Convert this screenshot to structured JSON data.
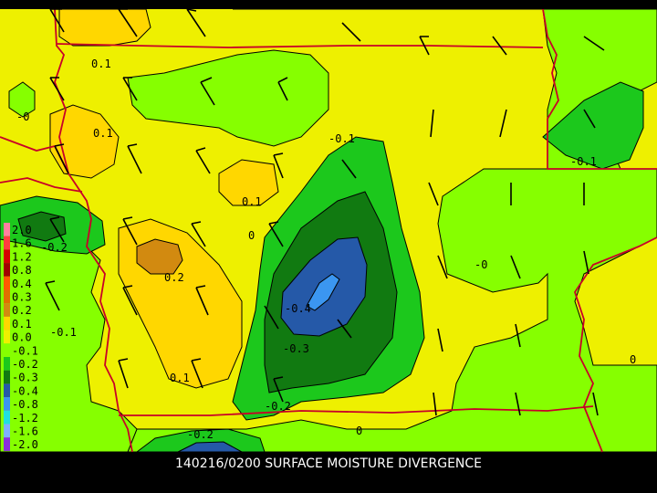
{
  "caption": "140216/0200 SURFACE MOISTURE DIVERGENCE",
  "legend": {
    "entries": [
      {
        "label": "2.0",
        "color": "#ff7f9f"
      },
      {
        "label": "1.6",
        "color": "#ff3f3f"
      },
      {
        "label": "1.2",
        "color": "#d40000"
      },
      {
        "label": "0.8",
        "color": "#a00000"
      },
      {
        "label": "0.4",
        "color": "#ff5a00"
      },
      {
        "label": "0.3",
        "color": "#e07000"
      },
      {
        "label": "0.2",
        "color": "#d28a10"
      },
      {
        "label": "0.1",
        "color": "#ffd700"
      },
      {
        "label": "0.0",
        "color": "#eef000"
      },
      {
        "label": "-0.1",
        "color": "#86ff00"
      },
      {
        "label": "-0.2",
        "color": "#1cc81c"
      },
      {
        "label": "-0.3",
        "color": "#117a11"
      },
      {
        "label": "-0.4",
        "color": "#2559a8"
      },
      {
        "label": "-0.8",
        "color": "#3b96f0"
      },
      {
        "label": "-1.2",
        "color": "#20e0e0"
      },
      {
        "label": "-1.6",
        "color": "#7fb0ff"
      },
      {
        "label": "-2.0",
        "color": "#8a30e0"
      }
    ]
  },
  "contour_labels": [
    {
      "text": "0.1"
    },
    {
      "text": "-0"
    },
    {
      "text": "0.1"
    },
    {
      "text": "-0.1"
    },
    {
      "text": "0.1"
    },
    {
      "text": "0"
    },
    {
      "text": "-0.2"
    },
    {
      "text": "0.2"
    },
    {
      "text": "-0.4"
    },
    {
      "text": "-0.3"
    },
    {
      "text": "0.1"
    },
    {
      "text": "-0.2"
    },
    {
      "text": "-0.2"
    },
    {
      "text": "0"
    },
    {
      "text": "-0.1"
    },
    {
      "text": "-0.1"
    },
    {
      "text": "-0"
    },
    {
      "text": "0"
    }
  ]
}
